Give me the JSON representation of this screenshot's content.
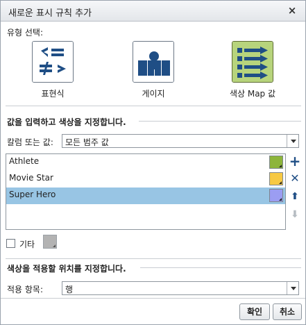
{
  "dialog": {
    "title": "새로운 표시 규칙 추가",
    "close_label": "×"
  },
  "type_selection": {
    "label": "유형 선택:",
    "options": [
      {
        "label": "표현식",
        "icon": "expression-icon",
        "selected": false
      },
      {
        "label": "게이지",
        "icon": "gauge-icon",
        "selected": false
      },
      {
        "label": "색상 Map 값",
        "icon": "color-map-icon",
        "selected": true
      }
    ]
  },
  "values_section": {
    "heading": "값을 입력하고 색상을 지정합니다.",
    "column_label": "칼럼 또는 값:",
    "column_value": "모든 범주 값",
    "items": [
      {
        "label": "Athlete",
        "color": "#8db53b"
      },
      {
        "label": "Movie Star",
        "color": "#f7c943"
      },
      {
        "label": "Super Hero",
        "color": "#9b9df2"
      }
    ],
    "selected_index": 2,
    "side_buttons": {
      "add": "+",
      "delete": "✕",
      "up": "⬆",
      "down": "⬇"
    },
    "other_label": "기타",
    "other_color": "#b3b3b3"
  },
  "apply_section": {
    "heading": "색상을 적용할 위치를 지정합니다.",
    "apply_label": "적용 항목:",
    "apply_value": "행"
  },
  "footer": {
    "ok_label": "확인",
    "cancel_label": "취소"
  },
  "colors": {
    "icon_blue": "#1f4e85",
    "icon_green": "#b7d47c",
    "selection": "#98c5e4"
  }
}
